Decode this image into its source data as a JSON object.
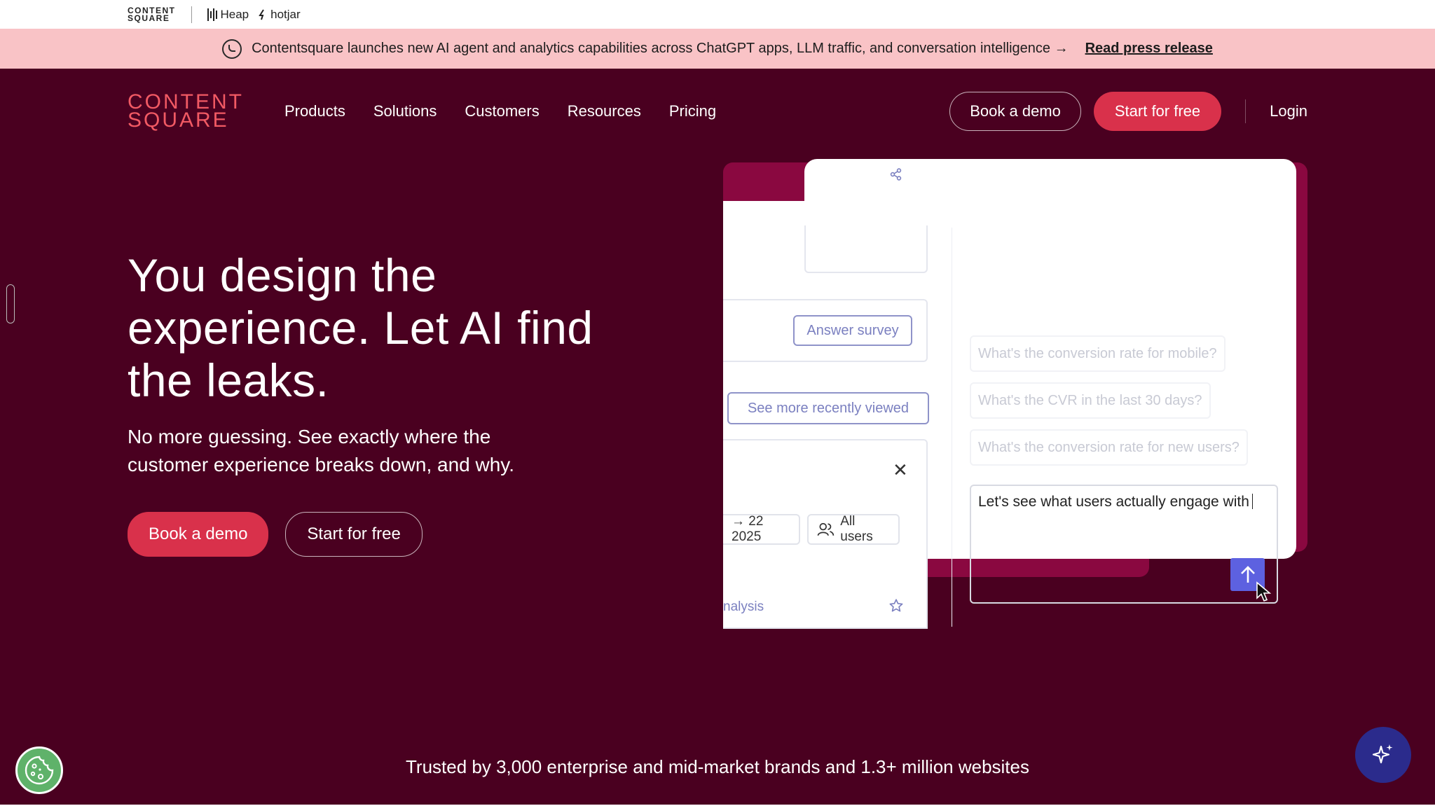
{
  "brandbar": {
    "contentsquare": [
      "CONTENT",
      "SQUARE"
    ],
    "heap": "Heap",
    "hotjar": "hotjar"
  },
  "announcement": {
    "text": "Contentsquare launches new AI agent and analytics capabilities across ChatGPT apps, LLM traffic, and conversation intelligence →",
    "link": "Read press release"
  },
  "nav": {
    "logo_line1": "CONTENT",
    "logo_line2": "SQUARE",
    "links": [
      "Products",
      "Solutions",
      "Customers",
      "Resources",
      "Pricing"
    ],
    "book_demo": "Book a demo",
    "start_free": "Start for free",
    "login": "Login"
  },
  "hero": {
    "headline": "You design the experience. Let AI find the leaks.",
    "subhead": "No more guessing. See exactly where the customer experience breaks down, and why.",
    "cta_primary": "Book a demo",
    "cta_secondary": "Start for free"
  },
  "mockup": {
    "answer_survey": "Answer survey",
    "see_more": "See more recently viewed",
    "date_chip": "→ 22 2025",
    "users_chip": "All users",
    "analysis": "nalysis",
    "suggestions": [
      "What's the conversion rate for mobile?",
      "What's the CVR in the last 30 days?",
      "What's the conversion rate for new users?"
    ],
    "composer_text": "Let's see what users actually engage with",
    "close_glyph": "✕"
  },
  "footer": {
    "trusted": "Trusted by 3,000 enterprise and mid-market brands and 1.3+ million websites"
  },
  "colors": {
    "hero_bg": "#4a0020",
    "accent_red": "#d9314b",
    "logo_coral": "#f25a64",
    "announce_bg": "#f9c3c6",
    "mock_magenta": "#8a0840",
    "violet": "#5d61e0"
  }
}
